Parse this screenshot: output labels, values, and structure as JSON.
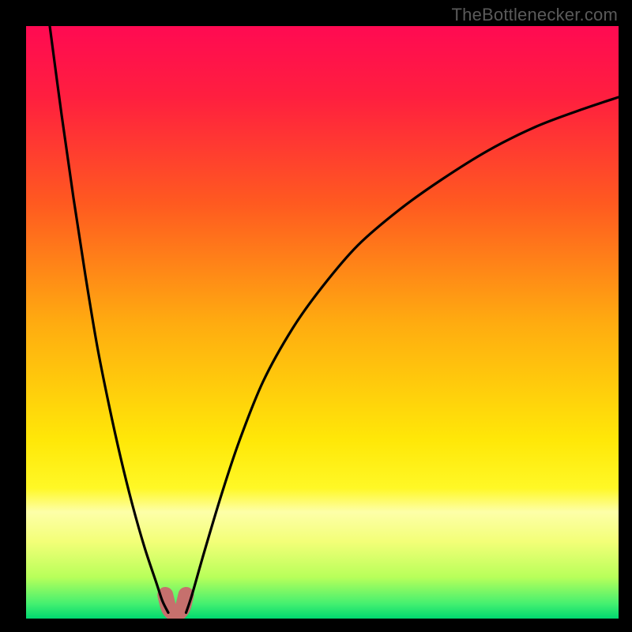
{
  "watermark": {
    "text": "TheBottlenecker.com"
  },
  "colors": {
    "gradient_stops": [
      {
        "offset": 0.0,
        "color": "#ff0a52"
      },
      {
        "offset": 0.12,
        "color": "#ff1f3f"
      },
      {
        "offset": 0.3,
        "color": "#ff5a20"
      },
      {
        "offset": 0.5,
        "color": "#ffab10"
      },
      {
        "offset": 0.7,
        "color": "#ffe808"
      },
      {
        "offset": 0.78,
        "color": "#fff826"
      },
      {
        "offset": 0.82,
        "color": "#fdffa8"
      },
      {
        "offset": 0.87,
        "color": "#f3ff78"
      },
      {
        "offset": 0.93,
        "color": "#b8ff5a"
      },
      {
        "offset": 0.975,
        "color": "#44f070"
      },
      {
        "offset": 1.0,
        "color": "#00d870"
      }
    ],
    "curve": "#000000",
    "nub": "#c6706d"
  },
  "chart_data": {
    "type": "line",
    "title": "",
    "xlabel": "",
    "ylabel": "",
    "xlim": [
      0,
      100
    ],
    "ylim": [
      0,
      100
    ],
    "series": [
      {
        "name": "left_curve",
        "x": [
          4,
          6,
          8,
          10,
          12,
          14,
          16,
          18,
          20,
          22,
          23,
          24
        ],
        "y": [
          100,
          85,
          71,
          58,
          46,
          36,
          27,
          19,
          12,
          6,
          3,
          1
        ]
      },
      {
        "name": "right_curve",
        "x": [
          27,
          28,
          30,
          33,
          36,
          40,
          45,
          50,
          56,
          63,
          70,
          78,
          86,
          94,
          100
        ],
        "y": [
          1,
          4,
          11,
          21,
          30,
          40,
          49,
          56,
          63,
          69,
          74,
          79,
          83,
          86,
          88
        ]
      },
      {
        "name": "nub",
        "x": [
          23.5,
          24.0,
          24.5,
          25.0,
          25.5,
          26.0,
          26.5,
          27.0
        ],
        "y": [
          4.0,
          2.0,
          1.2,
          1.0,
          1.0,
          1.2,
          2.0,
          4.0
        ]
      }
    ],
    "legend": false,
    "grid": false
  }
}
